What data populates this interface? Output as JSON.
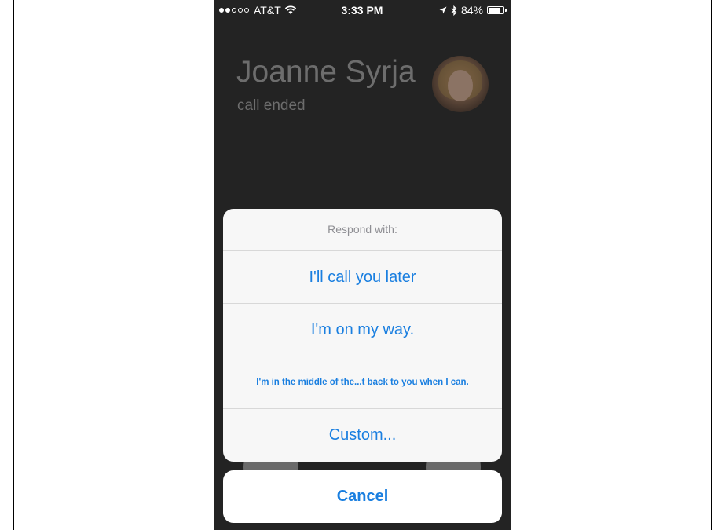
{
  "status_bar": {
    "carrier": "AT&T",
    "time": "3:33 PM",
    "battery": "84%",
    "battery_level": 0.84,
    "signal_bars_filled": 2,
    "signal_bars_total": 5
  },
  "call": {
    "caller_name": "Joanne Syrja",
    "status": "call ended"
  },
  "action_sheet": {
    "title": "Respond with:",
    "options": [
      "I'll call you later",
      "I'm on my way.",
      "I'm in the middle of the...t back to you when I can.",
      "Custom..."
    ],
    "cancel_label": "Cancel"
  },
  "colors": {
    "accent": "#1a7fe0",
    "background": "#232323",
    "sheet": "#f7f7f7"
  }
}
